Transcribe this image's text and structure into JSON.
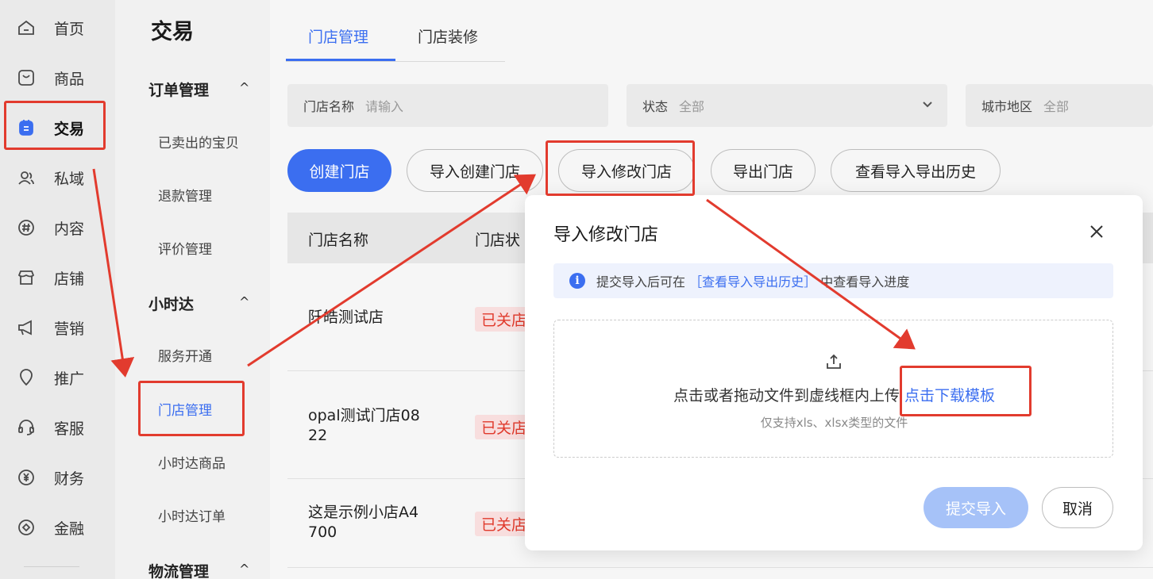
{
  "nav": {
    "items": [
      {
        "label": "首页",
        "icon": "home-icon"
      },
      {
        "label": "商品",
        "icon": "product-icon"
      },
      {
        "label": "交易",
        "icon": "trade-icon"
      },
      {
        "label": "私域",
        "icon": "users-icon"
      },
      {
        "label": "内容",
        "icon": "hashtag-icon"
      },
      {
        "label": "店铺",
        "icon": "shop-icon"
      },
      {
        "label": "营销",
        "icon": "megaphone-icon"
      },
      {
        "label": "推广",
        "icon": "location-icon"
      },
      {
        "label": "客服",
        "icon": "headset-icon"
      },
      {
        "label": "财务",
        "icon": "yuan-icon"
      },
      {
        "label": "金融",
        "icon": "finance-icon"
      }
    ],
    "active": "交易"
  },
  "subnav": {
    "title": "交易",
    "groups": [
      {
        "label": "订单管理",
        "caret": "^",
        "items": [
          "已卖出的宝贝",
          "退款管理",
          "评价管理"
        ]
      },
      {
        "label": "小时达",
        "caret": "^",
        "items": [
          "服务开通",
          "门店管理",
          "小时达商品",
          "小时达订单"
        ]
      },
      {
        "label": "物流管理",
        "caret": "^",
        "items": []
      }
    ],
    "active_item": "门店管理"
  },
  "tabs": [
    {
      "label": "门店管理"
    },
    {
      "label": "门店装修"
    }
  ],
  "filters": [
    {
      "label": "门店名称",
      "placeholder": "请输入"
    },
    {
      "label": "状态",
      "value": "全部"
    },
    {
      "label": "城市地区",
      "value": "全部"
    }
  ],
  "actions": {
    "create": "创建门店",
    "import_create": "导入创建门店",
    "import_modify": "导入修改门店",
    "export": "导出门店",
    "history": "查看导入导出历史"
  },
  "table": {
    "headers": [
      "门店名称",
      "门店状"
    ],
    "rows": [
      {
        "name": "阡皓测试店",
        "status": "已关店"
      },
      {
        "name": "opal测试门店08\n22",
        "status": "已关店"
      },
      {
        "name": "这是示例小店A4\n700",
        "status": "已关店"
      }
    ]
  },
  "modal": {
    "title": "导入修改门店",
    "notice_prefix": "提交导入后可在",
    "notice_link": "［查看导入导出历史］",
    "notice_suffix": "中查看导入进度",
    "drop_text": "点击或者拖动文件到虚线框内上传",
    "download_link": "点击下载模板",
    "hint": "仅支持xls、xlsx类型的文件",
    "submit": "提交导入",
    "cancel": "取消"
  },
  "colors": {
    "accent": "#3b6ef0",
    "annotation": "#e23b2e",
    "closed_status": "#e0392b"
  }
}
